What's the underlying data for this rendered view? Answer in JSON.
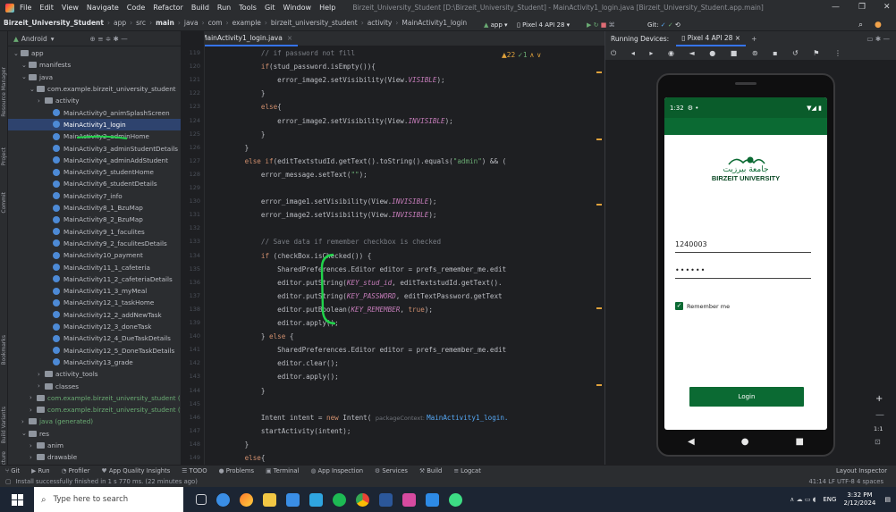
{
  "menubar": {
    "items": [
      "File",
      "Edit",
      "View",
      "Navigate",
      "Code",
      "Refactor",
      "Build",
      "Run",
      "Tools",
      "Git",
      "Window",
      "Help"
    ],
    "title": "Birzeit_University_Student [D:\\Birzeit_University_Student] - MainActivity1_login.java [Birzeit_University_Student.app.main]"
  },
  "breadcrumb": {
    "items": [
      "Birzeit_University_Student",
      "app",
      "src",
      "main",
      "java",
      "com",
      "example",
      "birzeit_university_student",
      "activity",
      "MainActivity1_login"
    ],
    "app_config": "app",
    "device": "Pixel 4 API 28",
    "git_label": "Git:"
  },
  "project_panel": {
    "header": "Android",
    "tree": [
      {
        "label": "app",
        "kind": "folder",
        "level": 0
      },
      {
        "label": "manifests",
        "kind": "folder",
        "level": 1
      },
      {
        "label": "java",
        "kind": "folder",
        "level": 1
      },
      {
        "label": "com.example.birzeit_university_student",
        "kind": "folder",
        "level": 2
      },
      {
        "label": "activity",
        "kind": "folder",
        "level": 3
      },
      {
        "label": "MainActivity0_animSplashScreen",
        "kind": "class",
        "level": 4
      },
      {
        "label": "MainActivity1_login",
        "kind": "class",
        "level": 4,
        "selected": true
      },
      {
        "label": "MainActivity2_adminHome",
        "kind": "class",
        "level": 4
      },
      {
        "label": "MainActivity3_adminStudentDetails",
        "kind": "class",
        "level": 4
      },
      {
        "label": "MainActivity4_adminAddStudent",
        "kind": "class",
        "level": 4
      },
      {
        "label": "MainActivity5_studentHome",
        "kind": "class",
        "level": 4
      },
      {
        "label": "MainActivity6_studentDetails",
        "kind": "class",
        "level": 4
      },
      {
        "label": "MainActivity7_info",
        "kind": "class",
        "level": 4
      },
      {
        "label": "MainActivity8_1_BzuMap",
        "kind": "class",
        "level": 4
      },
      {
        "label": "MainActivity8_2_BzuMap",
        "kind": "class",
        "level": 4
      },
      {
        "label": "MainActivity9_1_faculites",
        "kind": "class",
        "level": 4
      },
      {
        "label": "MainActivity9_2_faculitesDetails",
        "kind": "class",
        "level": 4
      },
      {
        "label": "MainActivity10_payment",
        "kind": "class",
        "level": 4
      },
      {
        "label": "MainActivity11_1_cafeteria",
        "kind": "class",
        "level": 4
      },
      {
        "label": "MainActivity11_2_cafeteriaDetails",
        "kind": "class",
        "level": 4
      },
      {
        "label": "MainActivity11_3_myMeal",
        "kind": "class",
        "level": 4
      },
      {
        "label": "MainActivity12_1_taskHome",
        "kind": "class",
        "level": 4
      },
      {
        "label": "MainActivity12_2_addNewTask",
        "kind": "class",
        "level": 4
      },
      {
        "label": "MainActivity12_3_doneTask",
        "kind": "class",
        "level": 4
      },
      {
        "label": "MainActivity12_4_DueTaskDetails",
        "kind": "class",
        "level": 4
      },
      {
        "label": "MainActivity12_5_DoneTaskDetails",
        "kind": "class",
        "level": 4
      },
      {
        "label": "MainActivity13_grade",
        "kind": "class",
        "level": 4
      },
      {
        "label": "activity_tools",
        "kind": "folder",
        "level": 3
      },
      {
        "label": "classes",
        "kind": "folder",
        "level": 3
      },
      {
        "label": "com.example.birzeit_university_student (androidTest)",
        "kind": "folder",
        "level": 2
      },
      {
        "label": "com.example.birzeit_university_student (test)",
        "kind": "folder",
        "level": 2
      },
      {
        "label": "java (generated)",
        "kind": "folder",
        "level": 1
      },
      {
        "label": "res",
        "kind": "folder",
        "level": 1
      },
      {
        "label": "anim",
        "kind": "folder",
        "level": 2
      },
      {
        "label": "drawable",
        "kind": "folder",
        "level": 2
      }
    ]
  },
  "left_strip": [
    "Resource Manager",
    "Project",
    "Commit",
    "Bookmarks",
    "Build Variants",
    "Structure"
  ],
  "editor": {
    "tab": "MainActivity1_login.java",
    "inspection": "22",
    "line_numbers": [
      "119",
      "120",
      "121",
      "122",
      "123",
      "124",
      "125",
      "126",
      "127",
      "128",
      "129",
      "130",
      "131",
      "132",
      "133",
      "134",
      "135",
      "136",
      "137",
      "138",
      "139",
      "140",
      "141",
      "142",
      "143",
      "144",
      "145",
      "146",
      "147",
      "148",
      "149"
    ],
    "code": [
      [
        {
          "t": "            "
        },
        {
          "t": "// if password not fill",
          "c": "c"
        }
      ],
      [
        {
          "t": "            "
        },
        {
          "t": "if",
          "c": "k"
        },
        {
          "t": "(stud_password.isEmpty()){"
        }
      ],
      [
        {
          "t": "                error_image2.setVisibility(View."
        },
        {
          "t": "VISIBLE",
          "c": "i"
        },
        {
          "t": ");"
        }
      ],
      [
        {
          "t": "            }"
        }
      ],
      [
        {
          "t": "            "
        },
        {
          "t": "else",
          "c": "k"
        },
        {
          "t": "{"
        }
      ],
      [
        {
          "t": "                error_image2.setVisibility(View."
        },
        {
          "t": "INVISIBLE",
          "c": "i"
        },
        {
          "t": ");"
        }
      ],
      [
        {
          "t": "            }"
        }
      ],
      [
        {
          "t": "        }"
        }
      ],
      [
        {
          "t": "        "
        },
        {
          "t": "else if",
          "c": "k"
        },
        {
          "t": "(editTextstudId.getText().toString().equals("
        },
        {
          "t": "\"admin\"",
          "c": "s"
        },
        {
          "t": ") && ("
        }
      ],
      [
        {
          "t": "            error_message.setText("
        },
        {
          "t": "\"\"",
          "c": "s"
        },
        {
          "t": ");"
        }
      ],
      [
        {
          "t": ""
        }
      ],
      [
        {
          "t": "            error_image1.setVisibility(View."
        },
        {
          "t": "INVISIBLE",
          "c": "i"
        },
        {
          "t": ");"
        }
      ],
      [
        {
          "t": "            error_image2.setVisibility(View."
        },
        {
          "t": "INVISIBLE",
          "c": "i"
        },
        {
          "t": ");"
        }
      ],
      [
        {
          "t": ""
        }
      ],
      [
        {
          "t": "            "
        },
        {
          "t": "// Save data if remember checkbox is checked",
          "c": "c"
        }
      ],
      [
        {
          "t": "            "
        },
        {
          "t": "if",
          "c": "k"
        },
        {
          "t": " (checkBox.isChecked()) {"
        }
      ],
      [
        {
          "t": "                SharedPreferences.Editor editor = prefs_remember_me.edit"
        }
      ],
      [
        {
          "t": "                editor.putString("
        },
        {
          "t": "KEY_stud_id",
          "c": "i"
        },
        {
          "t": ", editTextstudId.getText()."
        }
      ],
      [
        {
          "t": "                editor.putString("
        },
        {
          "t": "KEY_PASSWORD",
          "c": "i"
        },
        {
          "t": ", editTextPassword.getText"
        }
      ],
      [
        {
          "t": "                editor.putBoolean("
        },
        {
          "t": "KEY_REMEMBER",
          "c": "i"
        },
        {
          "t": ", "
        },
        {
          "t": "true",
          "c": "k"
        },
        {
          "t": ");"
        }
      ],
      [
        {
          "t": "                editor.apply();"
        }
      ],
      [
        {
          "t": "            } "
        },
        {
          "t": "else",
          "c": "k"
        },
        {
          "t": " {"
        }
      ],
      [
        {
          "t": "                SharedPreferences.Editor editor = prefs_remember_me.edit"
        }
      ],
      [
        {
          "t": "                editor.clear();"
        }
      ],
      [
        {
          "t": "                editor.apply();"
        }
      ],
      [
        {
          "t": "            }"
        }
      ],
      [
        {
          "t": ""
        }
      ],
      [
        {
          "t": "            Intent intent = "
        },
        {
          "t": "new",
          "c": "k"
        },
        {
          "t": " Intent( "
        },
        {
          "t": "packageContext: ",
          "c": "h"
        },
        {
          "t": "MainActivity1_login.",
          "c": "f"
        }
      ],
      [
        {
          "t": "            startActivity(intent);"
        }
      ],
      [
        {
          "t": "        }"
        }
      ],
      [
        {
          "t": "        "
        },
        {
          "t": "else",
          "c": "k"
        },
        {
          "t": "{"
        }
      ]
    ]
  },
  "devices_panel": {
    "label": "Running Devices:",
    "device": "Pixel 4 API 28"
  },
  "phone": {
    "time": "1:32",
    "logo_arabic": "جامعة بيرزيت",
    "logo_text": "BIRZEIT UNIVERSITY",
    "student_id": "1240003",
    "password": "••••••",
    "remember_label": "Remember me",
    "login_label": "Login"
  },
  "bottombar": {
    "items": [
      "Git",
      "Run",
      "Profiler",
      "App Quality Insights",
      "TODO",
      "Problems",
      "Terminal",
      "App Inspection",
      "Services",
      "Build",
      "Logcat"
    ],
    "right": "Layout Inspector"
  },
  "statusline": {
    "message": "Install successfully finished in 1 s 770 ms. (22 minutes ago)",
    "right": "41:14  LF  UTF-8    4 spaces"
  },
  "taskbar": {
    "search_placeholder": "Type here to search",
    "time": "3:32 PM",
    "date": "2/12/2024",
    "lang": "ENG"
  },
  "colors": {
    "accent_green": "#0b6a33",
    "selection": "#2e436e",
    "annotation_green": "#21d34b"
  }
}
